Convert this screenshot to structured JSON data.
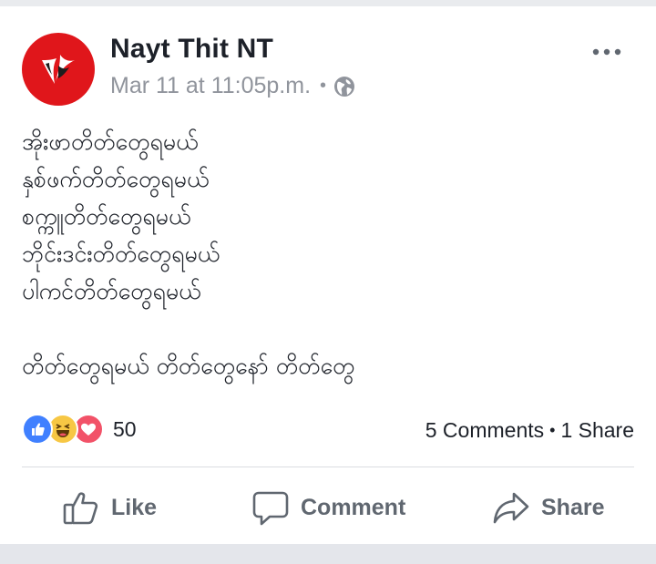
{
  "post": {
    "author": "Nayt Thit NT",
    "timestamp": "Mar 11 at 11:05p.m.",
    "meta_separator": "•",
    "privacy_icon": "globe-icon",
    "more_icon": "more-options-icon",
    "body_lines": [
      "အိုးဖာတိတ်တွေရမယ်",
      "နှစ်ဖက်တိတ်တွေရမယ်",
      "စက္ကူတိတ်တွေရမယ်",
      "ဘိုင်းဒင်းတိတ်တွေရမယ်",
      "ပါကင်တိတ်တွေရမယ်"
    ],
    "body_last_line": "တိတ်တွေရမယ် တိတ်တွေနော် တိတ်တွေ"
  },
  "reactions": {
    "icons": [
      "like-reaction-icon",
      "haha-reaction-icon",
      "love-reaction-icon"
    ],
    "count": "50",
    "comments": "5 Comments",
    "separator": "•",
    "shares": "1 Share"
  },
  "actions": {
    "like": "Like",
    "comment": "Comment",
    "share": "Share"
  },
  "colors": {
    "avatar_bg": "#e0161b",
    "like_blue": "#4080ff",
    "haha_yellow": "#f7c744",
    "love_red": "#f25268",
    "action_gray": "#606770",
    "meta_gray": "#90949c"
  }
}
